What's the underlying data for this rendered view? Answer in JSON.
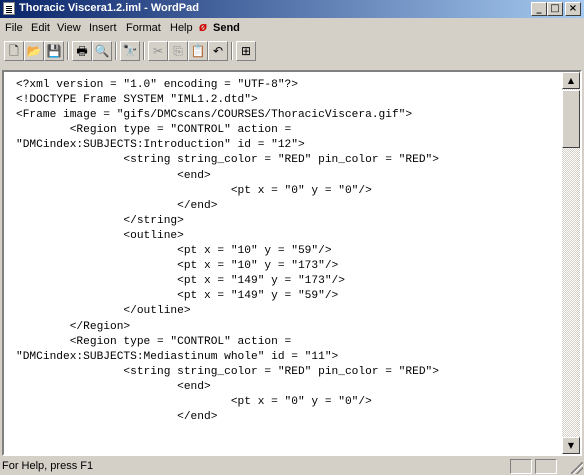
{
  "window": {
    "title": "Thoracic Viscera1.2.iml - WordPad",
    "buttons": {
      "minimize": "_",
      "maximize": "□",
      "close": "×"
    }
  },
  "menu": [
    "File",
    "Edit",
    "View",
    "Insert",
    "Format",
    "Help",
    "Send"
  ],
  "toolbar": {
    "new": "🗋",
    "open": "📂",
    "save": "💾",
    "print": "🖶",
    "preview": "🔍",
    "find": "🔭",
    "cut": "✂",
    "copy": "⎘",
    "paste": "📋",
    "undo": "↶",
    "insert_object": "⊞"
  },
  "document": {
    "lines": [
      "<?xml version = \"1.0\" encoding = \"UTF-8\"?>",
      "<!DOCTYPE Frame SYSTEM \"IML1.2.dtd\">",
      "<Frame image = \"gifs/DMCscans/COURSES/ThoracicViscera.gif\">",
      "        <Region type = \"CONTROL\" action =",
      "\"DMCindex:SUBJECTS:Introduction\" id = \"12\">",
      "                <string string_color = \"RED\" pin_color = \"RED\">",
      "                        <end>",
      "                                <pt x = \"0\" y = \"0\"/>",
      "                        </end>",
      "                </string>",
      "                <outline>",
      "                        <pt x = \"10\" y = \"59\"/>",
      "                        <pt x = \"10\" y = \"173\"/>",
      "                        <pt x = \"149\" y = \"173\"/>",
      "                        <pt x = \"149\" y = \"59\"/>",
      "                </outline>",
      "        </Region>",
      "        <Region type = \"CONTROL\" action =",
      "\"DMCindex:SUBJECTS:Mediastinum whole\" id = \"11\">",
      "                <string string_color = \"RED\" pin_color = \"RED\">",
      "                        <end>",
      "                                <pt x = \"0\" y = \"0\"/>",
      "                        </end>"
    ]
  },
  "status": {
    "text": "For Help, press F1"
  }
}
